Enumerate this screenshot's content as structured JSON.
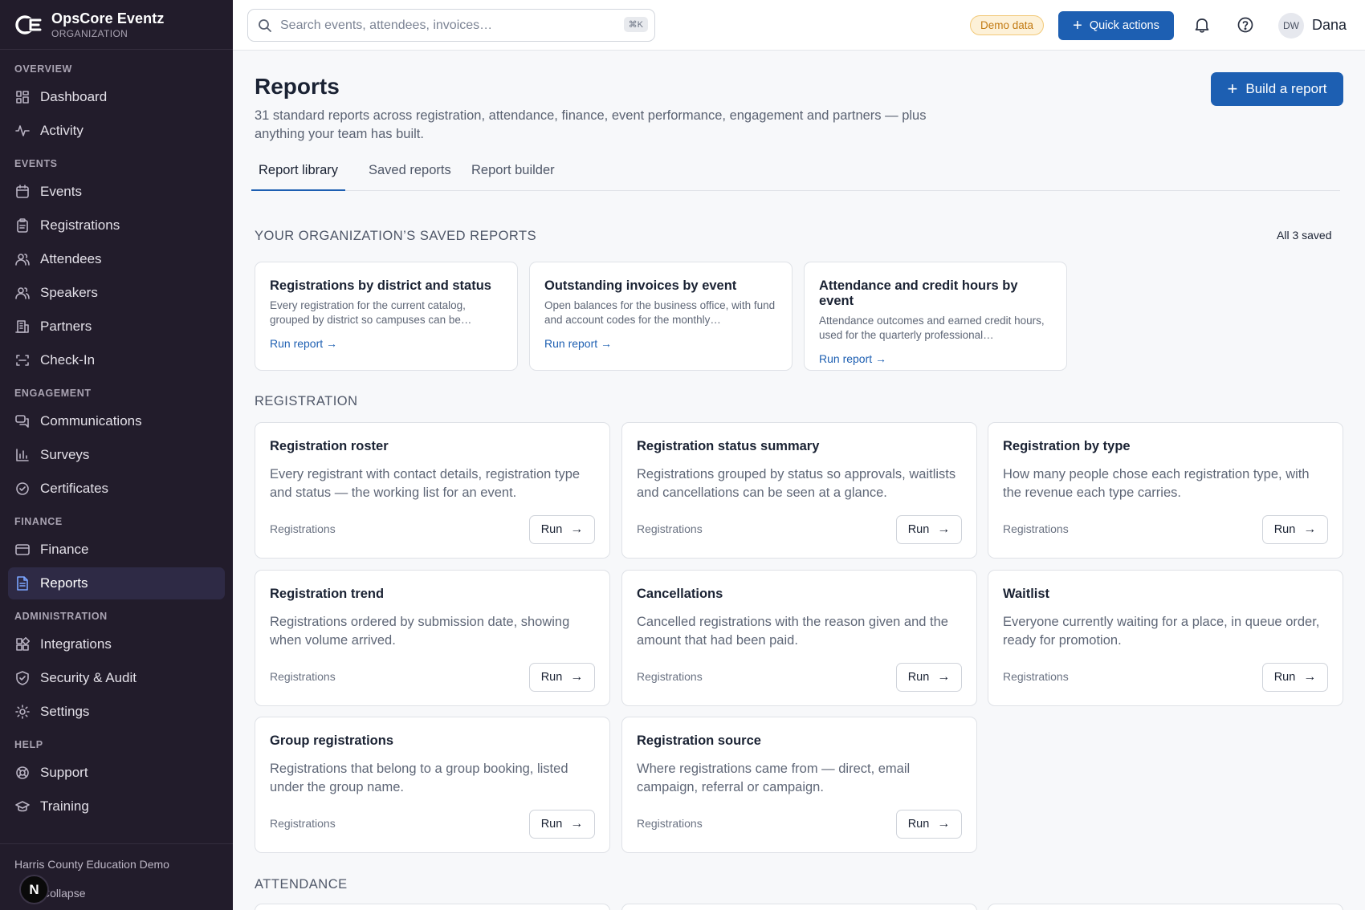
{
  "brand": {
    "name": "OpsCore Eventz",
    "subtitle": "ORGANIZATION"
  },
  "sidebar": {
    "sections": [
      {
        "label": "OVERVIEW",
        "items": [
          {
            "label": "Dashboard",
            "icon": "grid-icon"
          },
          {
            "label": "Activity",
            "icon": "activity-icon"
          }
        ]
      },
      {
        "label": "EVENTS",
        "items": [
          {
            "label": "Events",
            "icon": "calendar-icon"
          },
          {
            "label": "Registrations",
            "icon": "clipboard-icon"
          },
          {
            "label": "Attendees",
            "icon": "users-icon"
          },
          {
            "label": "Speakers",
            "icon": "users-icon"
          },
          {
            "label": "Partners",
            "icon": "building-icon"
          },
          {
            "label": "Check-In",
            "icon": "scan-icon"
          }
        ]
      },
      {
        "label": "ENGAGEMENT",
        "items": [
          {
            "label": "Communications",
            "icon": "chat-icon"
          },
          {
            "label": "Surveys",
            "icon": "bar-chart-icon"
          },
          {
            "label": "Certificates",
            "icon": "badge-check-icon"
          }
        ]
      },
      {
        "label": "FINANCE",
        "items": [
          {
            "label": "Finance",
            "icon": "credit-card-icon"
          },
          {
            "label": "Reports",
            "icon": "file-text-icon",
            "active": true
          }
        ]
      },
      {
        "label": "ADMINISTRATION",
        "items": [
          {
            "label": "Integrations",
            "icon": "puzzle-icon"
          },
          {
            "label": "Security & Audit",
            "icon": "shield-icon"
          },
          {
            "label": "Settings",
            "icon": "gear-icon"
          }
        ]
      },
      {
        "label": "HELP",
        "items": [
          {
            "label": "Support",
            "icon": "lifebuoy-icon"
          },
          {
            "label": "Training",
            "icon": "graduation-icon"
          }
        ]
      }
    ],
    "org_name": "Harris County Education Demo",
    "collapse_label": "Collapse",
    "n_badge": "N"
  },
  "topbar": {
    "search_placeholder": "Search events, attendees, invoices…",
    "shortcut": "⌘K",
    "demo_badge": "Demo data",
    "quick_actions": "Quick actions",
    "user_initials": "DW",
    "user_name": "Dana"
  },
  "page": {
    "title": "Reports",
    "subtitle": "31 standard reports across registration, attendance, finance, event performance, engagement and partners — plus anything your team has built.",
    "build_button": "Build a report",
    "tabs": [
      {
        "label": "Report library",
        "active": true
      },
      {
        "label": "Saved reports"
      },
      {
        "label": "Report builder"
      }
    ]
  },
  "saved": {
    "heading": "YOUR ORGANIZATION’S SAVED REPORTS",
    "count_label": "All 3 saved",
    "run_label": "Run report",
    "cards": [
      {
        "title": "Registrations by district and status",
        "description": "Every registration for the current catalog, grouped by district so campuses can be…"
      },
      {
        "title": "Outstanding invoices by event",
        "description": "Open balances for the business office, with fund and account codes for the monthly…"
      },
      {
        "title": "Attendance and credit hours by event",
        "description": "Attendance outcomes and earned credit hours, used for the quarterly professional…"
      }
    ]
  },
  "registration": {
    "heading": "REGISTRATION",
    "run_label": "Run",
    "cards": [
      {
        "title": "Registration roster",
        "description": "Every registrant with contact details, registration type and status — the working list for an event.",
        "category": "Registrations"
      },
      {
        "title": "Registration status summary",
        "description": "Registrations grouped by status so approvals, waitlists and cancellations can be seen at a glance.",
        "category": "Registrations"
      },
      {
        "title": "Registration by type",
        "description": "How many people chose each registration type, with the revenue each type carries.",
        "category": "Registrations"
      },
      {
        "title": "Registration trend",
        "description": "Registrations ordered by submission date, showing when volume arrived.",
        "category": "Registrations"
      },
      {
        "title": "Cancellations",
        "description": "Cancelled registrations with the reason given and the amount that had been paid.",
        "category": "Registrations"
      },
      {
        "title": "Waitlist",
        "description": "Everyone currently waiting for a place, in queue order, ready for promotion.",
        "category": "Registrations"
      },
      {
        "title": "Group registrations",
        "description": "Registrations that belong to a group booking, listed under the group name.",
        "category": "Registrations"
      },
      {
        "title": "Registration source",
        "description": "Where registrations came from — direct, email campaign, referral or campaign.",
        "category": "Registrations"
      }
    ]
  },
  "attendance": {
    "heading": "ATTENDANCE"
  },
  "colors": {
    "sidebar_bg": "#221c2b",
    "accent": "#1d5fb2",
    "active_item_bg": "#2e2a45",
    "demo_badge": "#c27a12"
  }
}
